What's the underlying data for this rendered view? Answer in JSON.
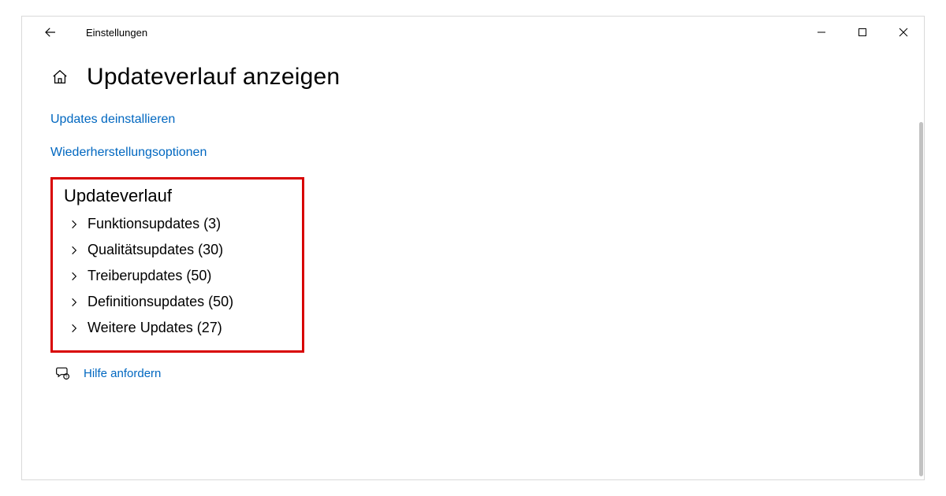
{
  "window": {
    "title": "Einstellungen"
  },
  "page": {
    "heading": "Updateverlauf anzeigen"
  },
  "links": {
    "uninstall": "Updates deinstallieren",
    "recovery": "Wiederherstellungsoptionen"
  },
  "history": {
    "title": "Updateverlauf",
    "categories": [
      {
        "label": "Funktionsupdates (3)"
      },
      {
        "label": "Qualitätsupdates (30)"
      },
      {
        "label": "Treiberupdates (50)"
      },
      {
        "label": "Definitionsupdates (50)"
      },
      {
        "label": "Weitere Updates (27)"
      }
    ]
  },
  "help": {
    "label": "Hilfe anfordern"
  }
}
